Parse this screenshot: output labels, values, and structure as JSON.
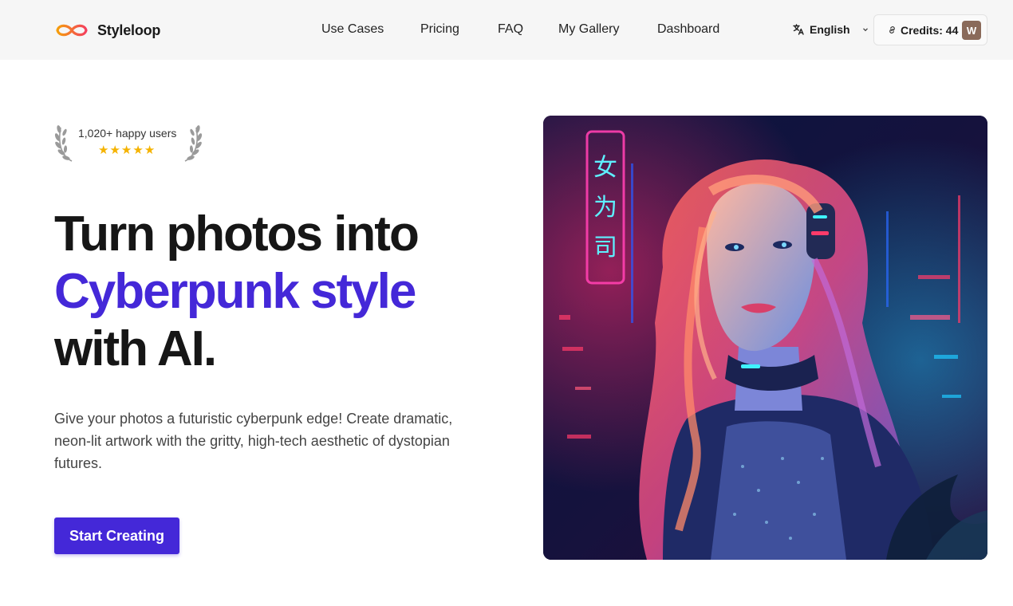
{
  "brand": {
    "name": "Styleloop",
    "accent_orange": "#f59e0b",
    "accent_pink": "#f43f5e"
  },
  "nav": {
    "links": [
      "Use Cases",
      "Pricing",
      "FAQ",
      "My Gallery",
      "Dashboard"
    ],
    "language": "English",
    "credits_label": "Credits: 44",
    "avatar_initial": "W"
  },
  "badge": {
    "text": "1,020+ happy users",
    "rating": 5
  },
  "hero": {
    "line1": "Turn photos into",
    "line2": "Cyberpunk style",
    "line3": "with AI.",
    "subtitle": "Give your photos a futuristic cyberpunk edge! Create dramatic, neon-lit artwork with the gritty, high-tech aesthetic of dystopian futures.",
    "cta": "Start Creating",
    "accent_color": "#4428d8",
    "neon_sign": "女 为 司"
  },
  "icons": {
    "logo": "infinity-logo-icon",
    "language": "translate-icon",
    "chevron": "chevron-down-icon",
    "credits": "link-icon",
    "laurel": "laurel-wreath-icon",
    "star": "star-icon"
  }
}
